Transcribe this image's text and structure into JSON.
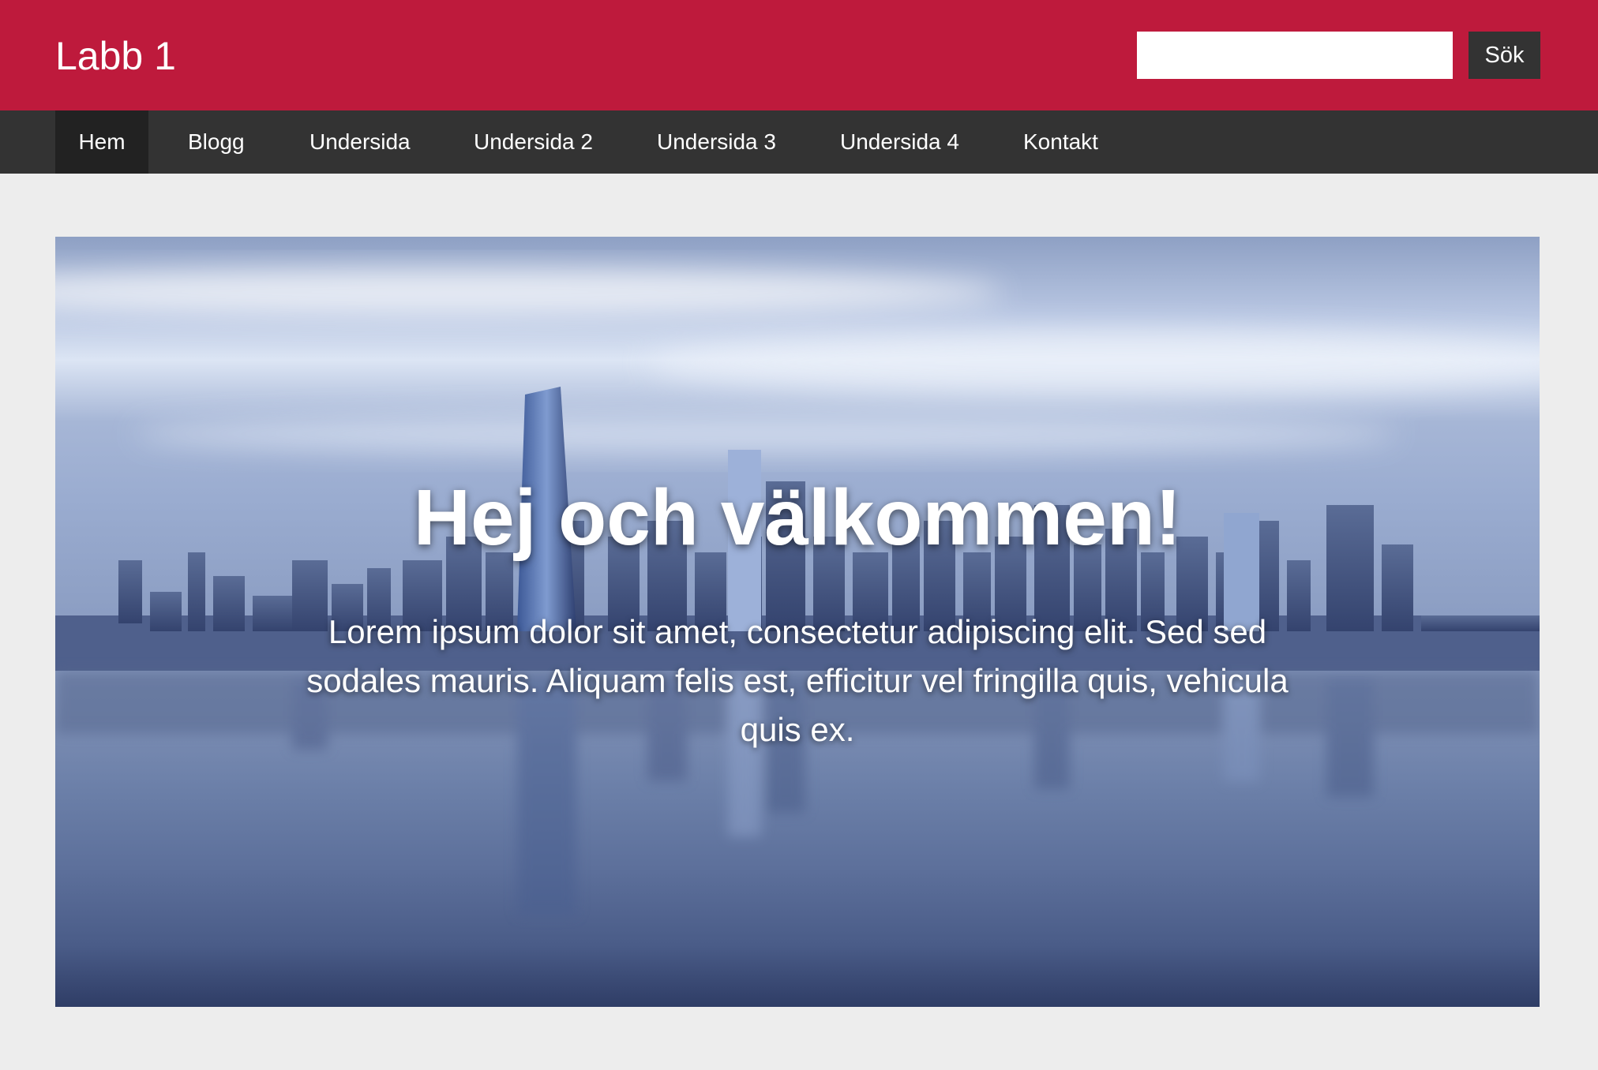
{
  "header": {
    "brand": "Labb 1",
    "search": {
      "value": "",
      "placeholder": "",
      "button_label": "Sök"
    }
  },
  "nav": {
    "items": [
      {
        "label": "Hem",
        "active": true
      },
      {
        "label": "Blogg",
        "active": false
      },
      {
        "label": "Undersida",
        "active": false
      },
      {
        "label": "Undersida 2",
        "active": false
      },
      {
        "label": "Undersida 3",
        "active": false
      },
      {
        "label": "Undersida 4",
        "active": false
      },
      {
        "label": "Kontakt",
        "active": false
      }
    ]
  },
  "hero": {
    "title": "Hej och välkommen!",
    "text": "Lorem ipsum dolor sit amet, consectetur adipiscing elit. Sed sed sodales mauris. Aliquam felis est, efficitur vel fringilla quis, vehicula quis ex."
  },
  "colors": {
    "header_bg": "#be1a3c",
    "nav_bg": "#333333",
    "nav_active_bg": "#222222",
    "page_bg": "#ededed"
  }
}
